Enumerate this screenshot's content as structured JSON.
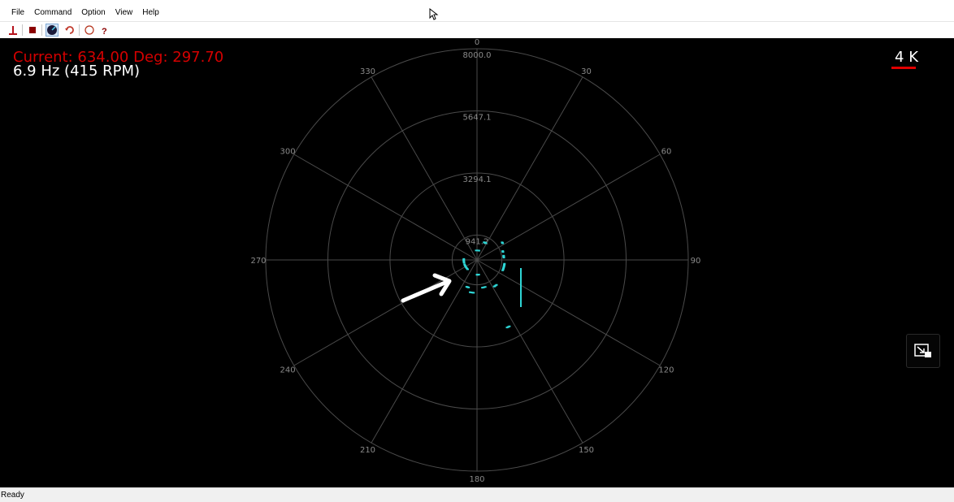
{
  "menu": {
    "items": [
      {
        "name": "menu-file",
        "label": "File"
      },
      {
        "name": "menu-command",
        "label": "Command"
      },
      {
        "name": "menu-option",
        "label": "Option"
      },
      {
        "name": "menu-view",
        "label": "View"
      },
      {
        "name": "menu-help",
        "label": "Help"
      }
    ]
  },
  "toolbar": {
    "buttons": [
      {
        "name": "connect-icon",
        "tooltip": "Connect"
      },
      {
        "name": "stop-icon",
        "tooltip": "Stop"
      },
      {
        "name": "scan-icon",
        "tooltip": "Scan"
      },
      {
        "name": "refresh-icon",
        "tooltip": "Reset"
      },
      {
        "name": "circle-icon",
        "tooltip": "Circle"
      },
      {
        "name": "help-icon",
        "tooltip": "?"
      }
    ]
  },
  "viewport": {
    "current_readout": "Current: 634.00 Deg: 297.70",
    "frequency_readout": "6.9 Hz (415 RPM)",
    "scale_label": "4 K",
    "colors": {
      "current": "#d40000",
      "scan_points": "#2fd6d6",
      "scale_bar": "#e00000"
    }
  },
  "chart_data": {
    "type": "scatter",
    "coordinate_system": "polar",
    "angle_ticks": [
      "0",
      "30",
      "60",
      "90",
      "120",
      "150",
      "180",
      "210",
      "240",
      "270",
      "300",
      "330"
    ],
    "radial_ticks": [
      "941.2",
      "3294.1",
      "5647.1",
      "8000.0"
    ],
    "radial_max": 8000,
    "scan_segments": [
      {
        "distance_mm": 720,
        "angles_deg": [
          22,
          23.5,
          25,
          26.5,
          28
        ]
      },
      {
        "distance_mm": 1160,
        "angles_deg": [
          55,
          56,
          57
        ]
      },
      {
        "distance_mm": 1030,
        "angles_deg": [
          71,
          72,
          73
        ]
      },
      {
        "distance_mm": 1020,
        "angles_deg": [
          81,
          82,
          83,
          84,
          85
        ]
      },
      {
        "distance_mm": 1050,
        "angles_deg": [
          98,
          100,
          102,
          104,
          106,
          108,
          110,
          112
        ]
      },
      {
        "distance_mm": 1200,
        "angles_deg": [
          142,
          144,
          146,
          147
        ]
      },
      {
        "distance_mm": 2800,
        "angles_deg": [
          154,
          155,
          156
        ]
      },
      {
        "distance_mm": 560,
        "angles_deg": [
          173,
          175,
          177,
          179,
          180
        ]
      },
      {
        "distance_mm": 1070,
        "angles_deg": [
          163,
          166,
          169
        ]
      },
      {
        "distance_mm": 1250,
        "angles_deg": [
          186,
          188,
          190,
          192
        ]
      },
      {
        "distance_mm": 1090,
        "angles_deg": [
          197,
          199,
          201
        ]
      },
      {
        "distance_mm": 500,
        "angles_deg": [
          225,
          230,
          235,
          240,
          245,
          250
        ]
      },
      {
        "distance_mm": 500,
        "angles_deg": [
          258,
          262,
          266,
          270,
          274
        ]
      },
      {
        "distance_mm": 360,
        "angles_deg": [
          355,
          5,
          12
        ]
      }
    ]
  },
  "statusbar": {
    "text": "Ready"
  }
}
